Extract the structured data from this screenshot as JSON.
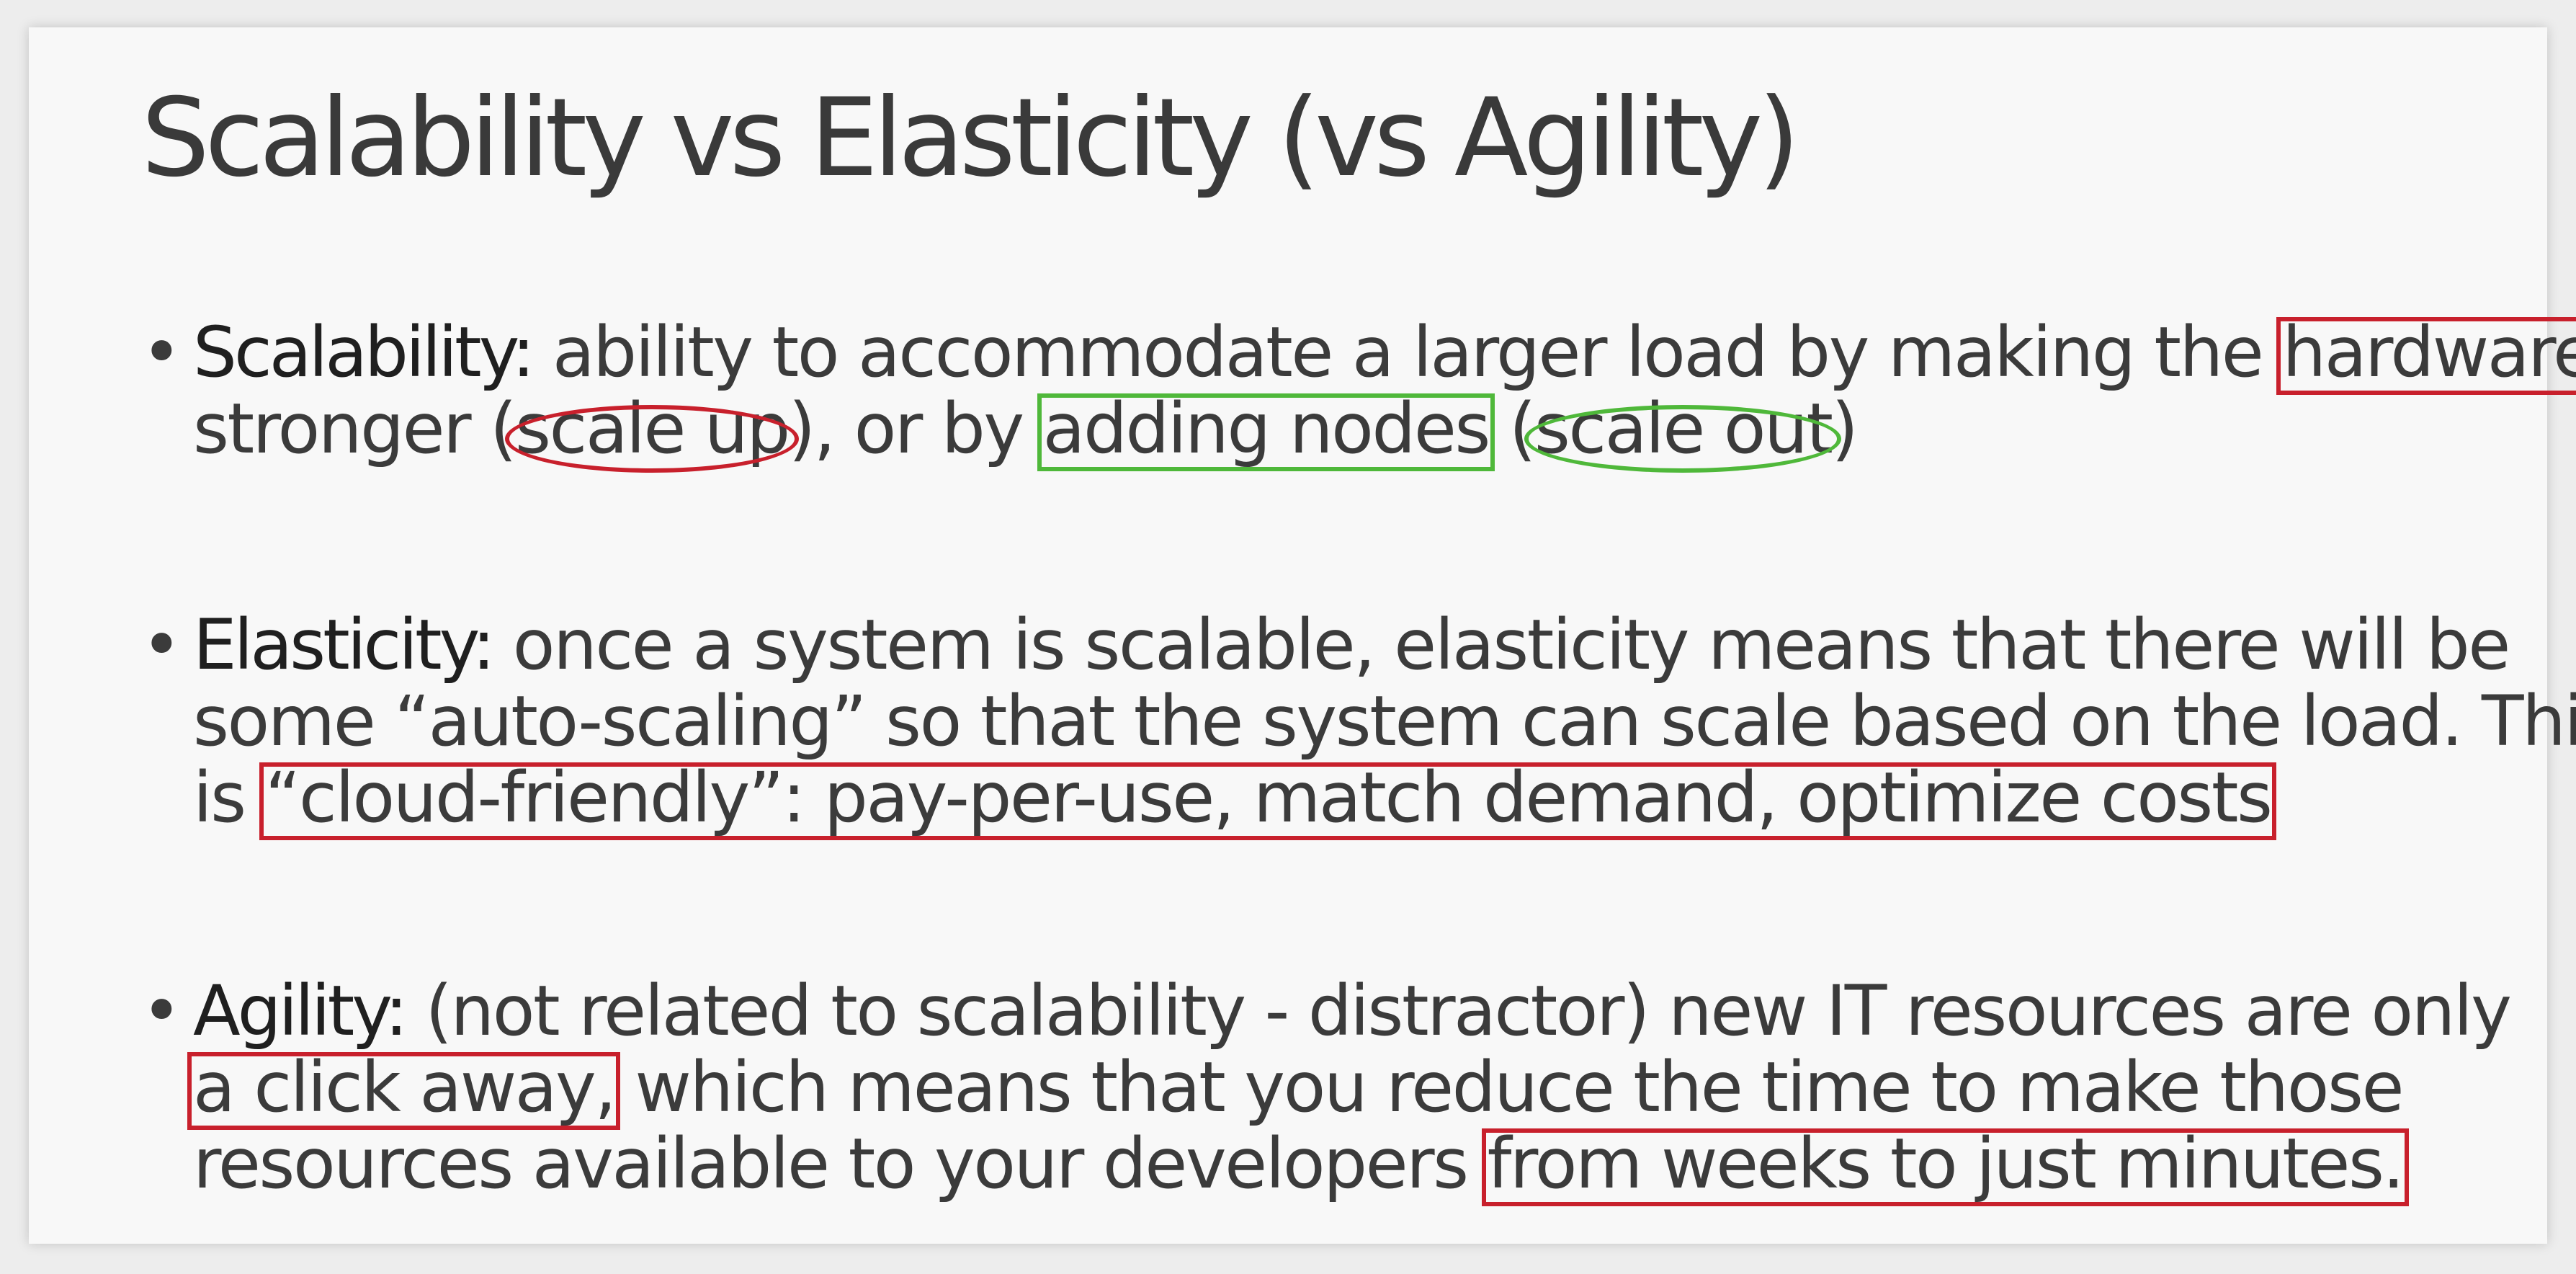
{
  "title": "Scalability vs Elasticity (vs Agility)",
  "bullet_char": "•",
  "scalability": {
    "term": "Scalability:",
    "t1": " ability to accommodate a larger load by making the ",
    "h1": "hardware",
    "t2": "stronger (",
    "h2": "scale up",
    "t3": "), or by ",
    "h3": "adding nodes",
    "t4": " (",
    "h4": "scale out",
    "t5": ")"
  },
  "elasticity": {
    "term": "Elasticity:",
    "t1": " once a system is scalable, elasticity means that there will be",
    "t2": "some “auto-scaling” so that the system can scale based on the load. This",
    "t3": "is ",
    "h1": "“cloud-friendly”: pay-per-use, match demand, optimize costs"
  },
  "agility": {
    "term": "Agility:",
    "t1": " (not related to scalability - distractor) new IT resources are only",
    "h1": "a click away,",
    "t2": " which means that you reduce the time to make those",
    "t3": "resources available to your developers ",
    "h2": "from weeks to just minutes."
  },
  "colors": {
    "highlight_red": "#c8202c",
    "highlight_green": "#4fb83a",
    "text": "#3b3b3b"
  }
}
